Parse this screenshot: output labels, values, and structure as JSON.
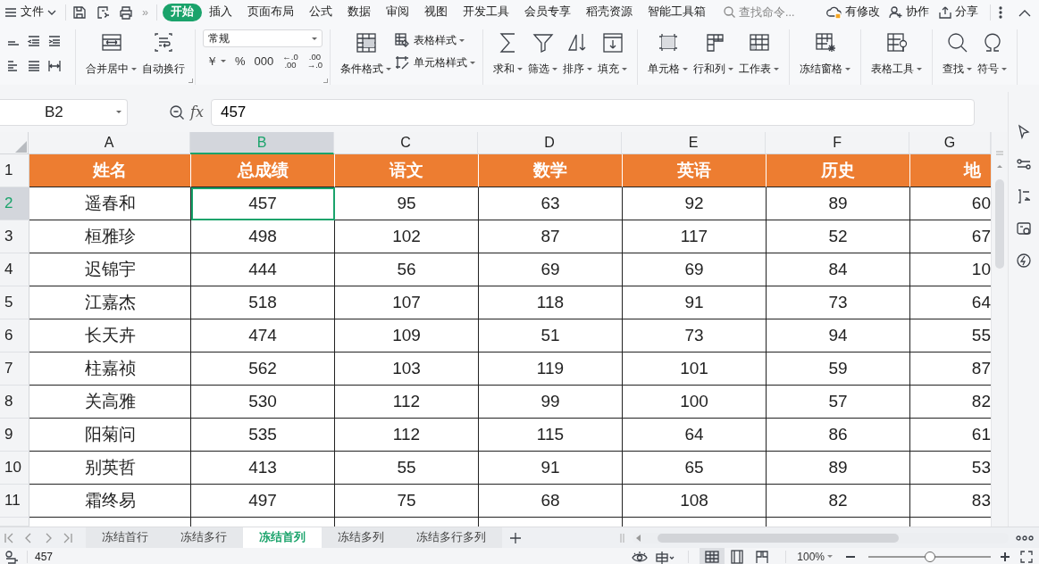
{
  "menubar": {
    "file_menu": "文件",
    "more": "»",
    "tabs": [
      {
        "label": "开始",
        "selected": true
      },
      {
        "label": "插入",
        "selected": false
      },
      {
        "label": "页面布局",
        "selected": false
      },
      {
        "label": "公式",
        "selected": false
      },
      {
        "label": "数据",
        "selected": false
      },
      {
        "label": "审阅",
        "selected": false
      },
      {
        "label": "视图",
        "selected": false
      },
      {
        "label": "开发工具",
        "selected": false
      },
      {
        "label": "会员专享",
        "selected": false
      },
      {
        "label": "稻壳资源",
        "selected": false
      },
      {
        "label": "智能工具箱",
        "selected": false
      }
    ],
    "search": {
      "placeholder": "查找命令..."
    },
    "actions": [
      "有修改",
      "协作",
      "分享"
    ]
  },
  "ribbon": {
    "groups": [
      {
        "launcher": true,
        "items": [
          {
            "kind": "large",
            "label": "合并居中",
            "dropdown": true
          },
          {
            "kind": "large",
            "label": "自动换行",
            "dropdown": false
          }
        ]
      },
      {
        "launcher": true,
        "items": [
          {
            "kind": "number",
            "format": "常规",
            "buttons": [
              {
                "lines": [
                  "￥"
                ],
                "dropdown": true
              },
              {
                "lines": [
                  "%"
                ],
                "dropdown": false
              },
              {
                "lines": [
                  "000"
                ],
                "dropdown": false
              },
              {
                "lines": [
                  "←.0",
                  ".00"
                ],
                "dropdown": false
              },
              {
                "lines": [
                  ".00",
                  "→.0"
                ],
                "dropdown": false
              }
            ]
          }
        ]
      },
      {
        "launcher": false,
        "items": [
          {
            "kind": "large",
            "label": "条件格式",
            "dropdown": true
          },
          {
            "kind": "stack",
            "items": [
              {
                "label": "表格样式",
                "dropdown": true
              },
              {
                "label": "单元格样式",
                "dropdown": true
              }
            ]
          }
        ]
      },
      {
        "launcher": false,
        "items": [
          {
            "kind": "large",
            "label": "求和",
            "dropdown": true
          },
          {
            "kind": "large",
            "label": "筛选",
            "dropdown": true
          },
          {
            "kind": "large",
            "label": "排序",
            "dropdown": true
          },
          {
            "kind": "large",
            "label": "填充",
            "dropdown": true
          }
        ]
      },
      {
        "launcher": false,
        "items": [
          {
            "kind": "large",
            "label": "单元格",
            "dropdown": true
          },
          {
            "kind": "large",
            "label": "行和列",
            "dropdown": true
          },
          {
            "kind": "large",
            "label": "工作表",
            "dropdown": true
          }
        ]
      },
      {
        "launcher": false,
        "items": [
          {
            "kind": "large",
            "label": "冻结窗格",
            "dropdown": true
          }
        ]
      },
      {
        "launcher": false,
        "items": [
          {
            "kind": "large",
            "label": "表格工具",
            "dropdown": true
          }
        ]
      },
      {
        "launcher": false,
        "items": [
          {
            "kind": "large",
            "label": "查找",
            "dropdown": true
          },
          {
            "kind": "large",
            "label": "符号",
            "dropdown": true
          }
        ]
      }
    ]
  },
  "formula_bar": {
    "name_box": "B2",
    "fx": "fx",
    "value": "457"
  },
  "sheet": {
    "columns": [
      {
        "label": "A",
        "selected": false
      },
      {
        "label": "B",
        "selected": true
      },
      {
        "label": "C",
        "selected": false
      },
      {
        "label": "D",
        "selected": false
      },
      {
        "label": "E",
        "selected": false
      },
      {
        "label": "F",
        "selected": false
      },
      {
        "label": "G",
        "selected": false
      }
    ],
    "rows": [
      {
        "label": "1",
        "kind": "header",
        "selected": false,
        "cells": [
          "姓名",
          "总成绩",
          "语文",
          "数学",
          "英语",
          "历史",
          "地"
        ]
      },
      {
        "label": "2",
        "kind": "data",
        "selected": true,
        "cells": [
          "遥春和",
          "457",
          "95",
          "63",
          "92",
          "89",
          "60"
        ]
      },
      {
        "label": "3",
        "kind": "data",
        "selected": false,
        "cells": [
          "桓雅珍",
          "498",
          "102",
          "87",
          "117",
          "52",
          "67"
        ]
      },
      {
        "label": "4",
        "kind": "data",
        "selected": false,
        "cells": [
          "迟锦宇",
          "444",
          "56",
          "69",
          "69",
          "84",
          "10"
        ]
      },
      {
        "label": "5",
        "kind": "data",
        "selected": false,
        "cells": [
          "江嘉杰",
          "518",
          "107",
          "118",
          "91",
          "73",
          "64"
        ]
      },
      {
        "label": "6",
        "kind": "data",
        "selected": false,
        "cells": [
          "长天卉",
          "474",
          "109",
          "51",
          "73",
          "94",
          "55"
        ]
      },
      {
        "label": "7",
        "kind": "data",
        "selected": false,
        "cells": [
          "柱嘉祯",
          "562",
          "103",
          "119",
          "101",
          "59",
          "87"
        ]
      },
      {
        "label": "8",
        "kind": "data",
        "selected": false,
        "cells": [
          "关高雅",
          "530",
          "112",
          "99",
          "100",
          "57",
          "82"
        ]
      },
      {
        "label": "9",
        "kind": "data",
        "selected": false,
        "cells": [
          "阳菊问",
          "535",
          "112",
          "115",
          "64",
          "86",
          "61"
        ]
      },
      {
        "label": "10",
        "kind": "data",
        "selected": false,
        "cells": [
          "别英哲",
          "413",
          "55",
          "91",
          "65",
          "89",
          "53"
        ]
      },
      {
        "label": "11",
        "kind": "data",
        "selected": false,
        "cells": [
          "霜终易",
          "497",
          "75",
          "68",
          "108",
          "82",
          "83"
        ]
      }
    ]
  },
  "sheet_tabs": [
    {
      "label": "冻结首行",
      "selected": false
    },
    {
      "label": "冻结多行",
      "selected": false
    },
    {
      "label": "冻结首列",
      "selected": true
    },
    {
      "label": "冻结多列",
      "selected": false
    },
    {
      "label": "冻结多行多列",
      "selected": false
    }
  ],
  "status_bar": {
    "value": "457",
    "zoom": "100%",
    "zoom_slider": {
      "level": 0.5
    },
    "views": [
      {
        "selected": true
      },
      {
        "selected": false
      },
      {
        "selected": false
      }
    ]
  }
}
